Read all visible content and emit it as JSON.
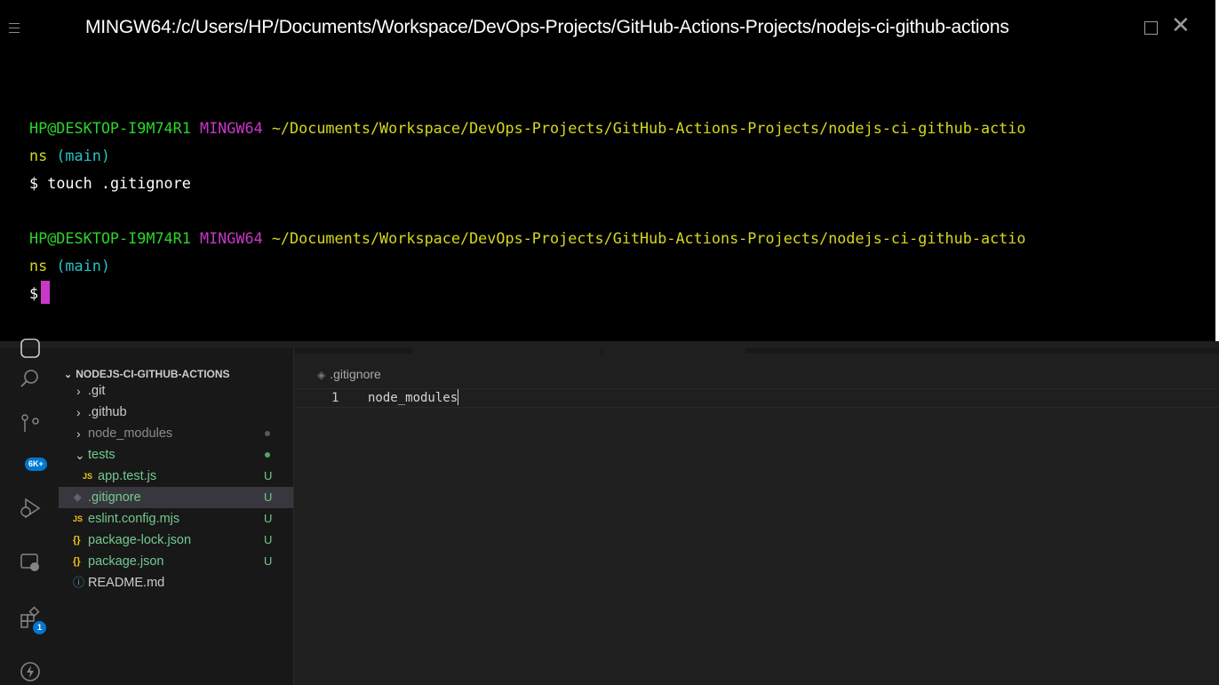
{
  "terminal": {
    "title": "MINGW64:/c/Users/HP/Documents/Workspace/DevOps-Projects/GitHub-Actions-Projects/nodejs-ci-github-actions",
    "blocks": [
      {
        "user_host": "HP@DESKTOP-I9M74R1",
        "env": "MINGW64",
        "path": "~/Documents/Workspace/DevOps-Projects/GitHub-Actions-Projects/nodejs-ci-github-actio",
        "path_wrap": "ns",
        "branch": "(main)",
        "prompt": "$",
        "command": "touch .gitignore"
      },
      {
        "user_host": "HP@DESKTOP-I9M74R1",
        "env": "MINGW64",
        "path": "~/Documents/Workspace/DevOps-Projects/GitHub-Actions-Projects/nodejs-ci-github-actio",
        "path_wrap": "ns",
        "branch": "(main)",
        "prompt": "$",
        "command": ""
      }
    ],
    "colors": {
      "user": "#2ad42a",
      "env": "#c837c8",
      "path": "#d6d61e",
      "branch": "#27c0c8",
      "cursor": "#c837c8"
    }
  },
  "activity_bar": {
    "items": [
      {
        "icon": "explorer-icon"
      },
      {
        "icon": "search-icon"
      },
      {
        "icon": "source-control-icon",
        "badge": "6K+"
      },
      {
        "icon": "run-debug-icon"
      },
      {
        "icon": "remote-explorer-icon"
      },
      {
        "icon": "extensions-icon",
        "badge": "1"
      },
      {
        "icon": "thunder-client-icon"
      }
    ]
  },
  "explorer": {
    "header": "NODEJS-CI-GITHUB-ACTIONS",
    "items": [
      {
        "label": ".git",
        "twisty": "›",
        "status": ""
      },
      {
        "label": ".github",
        "twisty": "›",
        "status": ""
      },
      {
        "label": "node_modules",
        "twisty": "›",
        "status": "dot"
      },
      {
        "label": "tests",
        "twisty": "⌄",
        "status": "dot"
      },
      {
        "label": "app.test.js",
        "icon": "JS",
        "status": "U"
      },
      {
        "label": ".gitignore",
        "icon": "◈",
        "status": "U"
      },
      {
        "label": "eslint.config.mjs",
        "icon": "JS",
        "status": "U"
      },
      {
        "label": "package-lock.json",
        "icon": "{}",
        "status": "U"
      },
      {
        "label": "package.json",
        "icon": "{}",
        "status": "U"
      },
      {
        "label": "README.md",
        "icon": "ⓘ",
        "status": ""
      }
    ]
  },
  "editor": {
    "breadcrumb": ".gitignore",
    "lines": [
      {
        "number": "1",
        "text": "node_modules"
      }
    ]
  }
}
